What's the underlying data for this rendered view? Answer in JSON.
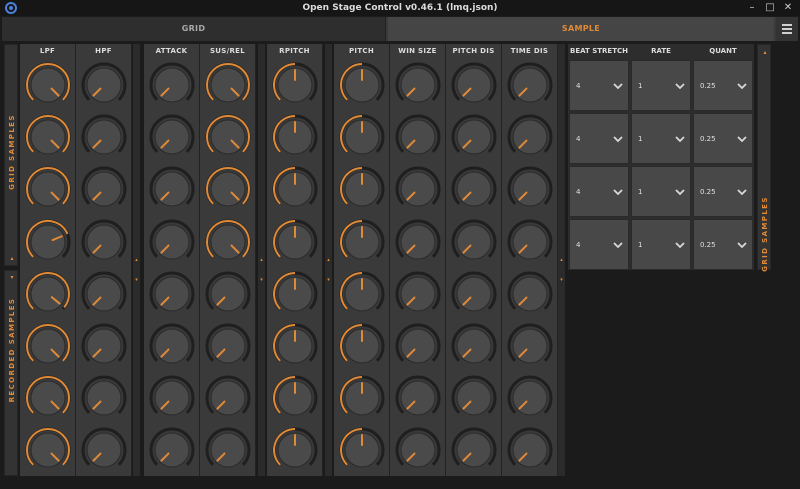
{
  "window": {
    "title": "Open Stage Control v0.46.1 (lmq.json)"
  },
  "tabs": [
    {
      "label": "GRID",
      "active": false
    },
    {
      "label": "SAMPLE",
      "active": true
    }
  ],
  "accent_color": "#e08a37",
  "left_panels": [
    {
      "label": "GRID SAMPLES",
      "collapse_arrow": "▴"
    },
    {
      "label": "RECORDED SAMPLES",
      "collapse_arrow": "▾"
    }
  ],
  "right_panel": {
    "label": "GRID SAMPLES",
    "collapse_arrow": "▴"
  },
  "separator_arrows": [
    "▴",
    "▾"
  ],
  "knob_groups": [
    {
      "columns": [
        {
          "header": "LPF",
          "values": [
            1.0,
            1.0,
            1.0,
            0.75,
            0.98,
            1.0,
            1.0,
            1.0
          ]
        },
        {
          "header": "HPF",
          "values": [
            0.0,
            0.0,
            0.0,
            0.0,
            0.0,
            0.0,
            0.0,
            0.0
          ]
        }
      ]
    },
    {
      "columns": [
        {
          "header": "ATTACK",
          "values": [
            0.0,
            0.0,
            0.0,
            0.0,
            0.0,
            0.0,
            0.0,
            0.0
          ]
        },
        {
          "header": "SUS/REL",
          "values": [
            1.0,
            1.0,
            1.0,
            1.0,
            0.0,
            0.0,
            0.0,
            0.0
          ]
        }
      ]
    },
    {
      "columns": [
        {
          "header": "RPITCH",
          "values": [
            0.5,
            0.5,
            0.5,
            0.5,
            0.5,
            0.5,
            0.5,
            0.5
          ]
        }
      ]
    },
    {
      "columns": [
        {
          "header": "PITCH",
          "values": [
            0.5,
            0.5,
            0.5,
            0.5,
            0.5,
            0.5,
            0.5,
            0.5
          ]
        },
        {
          "header": "WIN SIZE",
          "values": [
            0.0,
            0.0,
            0.0,
            0.0,
            0.0,
            0.0,
            0.0,
            0.0
          ]
        },
        {
          "header": "PITCH DIS",
          "values": [
            0.0,
            0.0,
            0.0,
            0.0,
            0.0,
            0.0,
            0.0,
            0.0
          ]
        },
        {
          "header": "TIME DIS",
          "values": [
            0.0,
            0.0,
            0.0,
            0.0,
            0.0,
            0.0,
            0.0,
            0.0
          ]
        }
      ]
    }
  ],
  "sample_table": {
    "headers": [
      "BEAT STRETCH",
      "RATE",
      "QUANT"
    ],
    "rows": [
      [
        "4",
        "1",
        "0.25"
      ],
      [
        "4",
        "1",
        "0.25"
      ],
      [
        "4",
        "1",
        "0.25"
      ],
      [
        "4",
        "1",
        "0.25"
      ]
    ]
  }
}
